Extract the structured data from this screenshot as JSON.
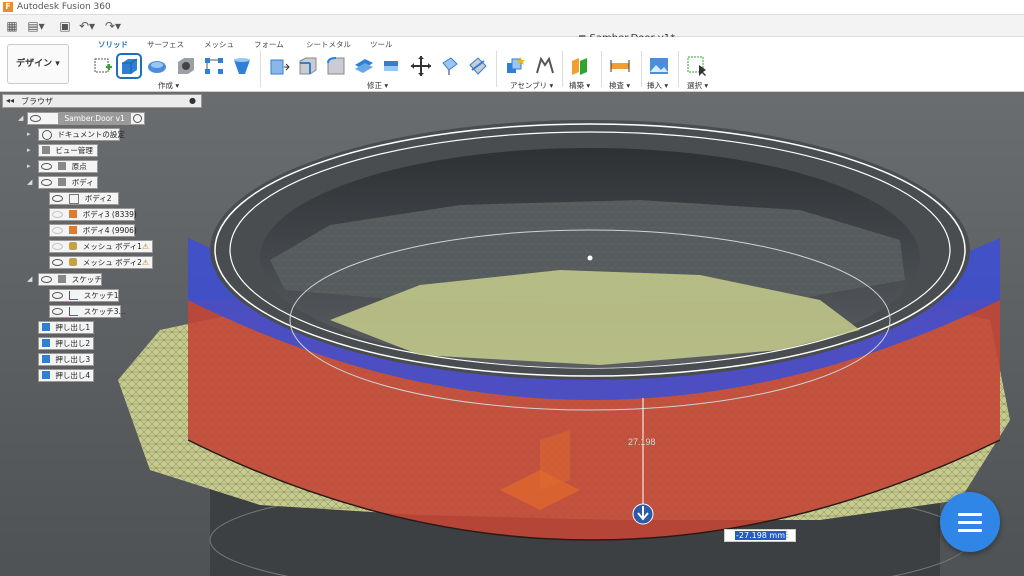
{
  "app": {
    "title": "Autodesk Fusion 360",
    "logo": "F"
  },
  "document": {
    "tab_title": "Samber.Door v1*"
  },
  "ribbon": {
    "workspace": "デザイン ▾",
    "tabs": [
      "ソリッド",
      "サーフェス",
      "メッシュ",
      "フォーム",
      "シートメタル",
      "ツール"
    ],
    "groups": [
      "作成 ▾",
      "修正 ▾",
      "アセンブリ ▾",
      "構築 ▾",
      "検査 ▾",
      "挿入 ▾",
      "選択 ▾"
    ]
  },
  "browser": {
    "title": "ブラウザ",
    "root": "Samber.Door v1",
    "items": [
      "ドキュメントの設定",
      "ビュー管理",
      "原点",
      "ボディ"
    ],
    "bodies": [
      "ボディ2",
      "ボディ3 (8339)",
      "ボディ4 (9906)",
      "メッシュ ボディ1",
      "メッシュ ボディ2"
    ],
    "sketch_folder": "スケッチ",
    "sketches": [
      "スケッチ1",
      "スケッチ3..."
    ],
    "extrudes": [
      "押し出し1",
      "押し出し2",
      "押し出し3",
      "押し出し4"
    ]
  },
  "viewport": {
    "dimension_label": "27.198",
    "dimension_input": "-27.198 mm",
    "colors": {
      "blue_face": "#3f4fd0",
      "red_face": "#c84a3a",
      "mesh": "#c7cc8c",
      "cylinder": "#3a3d40"
    }
  }
}
